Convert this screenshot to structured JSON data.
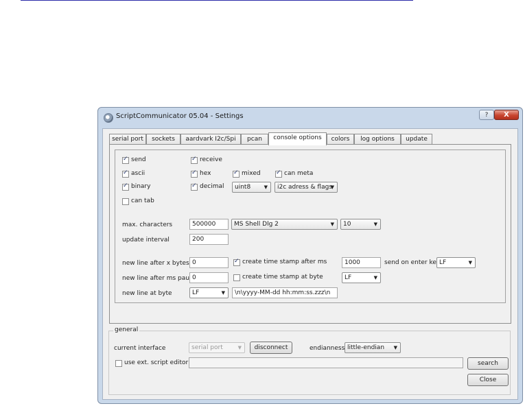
{
  "window": {
    "title": "ScriptCommunicator 05.04 - Settings",
    "help_label": "?",
    "close_label": "X"
  },
  "tabs": [
    {
      "label": "serial port",
      "active": false
    },
    {
      "label": "sockets",
      "active": false
    },
    {
      "label": "aardvark I2c/Spi",
      "active": false
    },
    {
      "label": "pcan",
      "active": false
    },
    {
      "label": "console options",
      "active": true
    },
    {
      "label": "colors",
      "active": false
    },
    {
      "label": "log options",
      "active": false
    },
    {
      "label": "update",
      "active": false
    }
  ],
  "console": {
    "send": {
      "label": "send",
      "checked": true
    },
    "receive": {
      "label": "receive",
      "checked": true
    },
    "ascii": {
      "label": "ascii",
      "checked": true
    },
    "hex": {
      "label": "hex",
      "checked": true
    },
    "mixed": {
      "label": "mixed",
      "checked": true
    },
    "can_meta": {
      "label": "can meta",
      "checked": true
    },
    "binary": {
      "label": "binary",
      "checked": true
    },
    "decimal": {
      "label": "decimal",
      "checked": true
    },
    "decimal_type": "uint8",
    "i2c_mode": "i2c adress & flags",
    "can_tab": {
      "label": "can tab",
      "checked": false
    },
    "max_characters_label": "max. characters",
    "max_characters_value": "500000",
    "font": "MS Shell Dlg 2",
    "font_size": "10",
    "update_interval_label": "update interval",
    "update_interval_value": "200",
    "new_line_bytes_label": "new line after x bytes",
    "new_line_bytes_value": "0",
    "timestamp_ms": {
      "label": "create time stamp after ms",
      "checked": true
    },
    "timestamp_ms_value": "1000",
    "send_on_enter_label": "send on enter key",
    "send_on_enter_value": "LF",
    "new_line_pause_label": "new line after ms pause",
    "new_line_pause_value": "0",
    "timestamp_byte": {
      "label": "create time stamp at byte",
      "checked": false
    },
    "timestamp_byte_value": "LF",
    "new_line_at_byte_label": "new line at byte",
    "new_line_at_byte_value": "LF",
    "timestamp_format": "\\n\\yyyy-MM-dd hh:mm:ss.zzz\\n"
  },
  "general": {
    "title": "general",
    "current_interface_label": "current interface",
    "current_interface_value": "serial port",
    "disconnect_label": "disconnect",
    "endianness_label": "endianness",
    "endianness_value": "little-endian",
    "ext_editor": {
      "label": "use ext. script editor",
      "checked": false
    },
    "ext_editor_path": "",
    "search_label": "search",
    "close_label": "Close"
  },
  "icons": {
    "arrow": "▼"
  }
}
